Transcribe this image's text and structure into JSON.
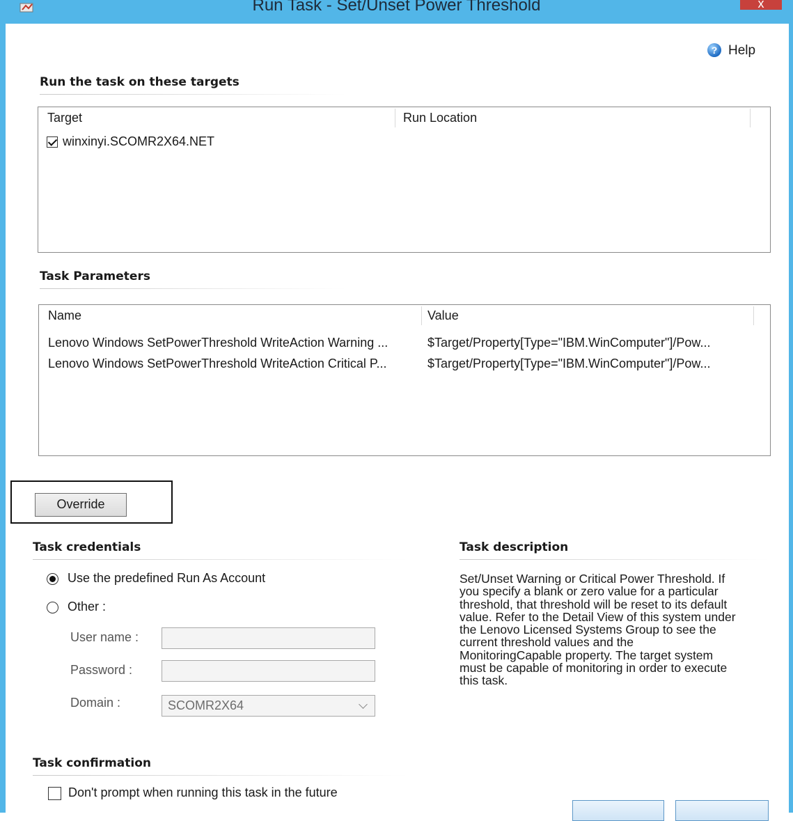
{
  "window": {
    "title": "Run Task - Set/Unset Power Threshold",
    "close_glyph": "x"
  },
  "help": {
    "label": "Help",
    "icon": "help-icon"
  },
  "targets": {
    "heading": "Run the task on these targets",
    "columns": [
      "Target",
      "Run Location"
    ],
    "rows": [
      {
        "checked": true,
        "target": "winxinyi.SCOMR2X64.NET",
        "run_location": ""
      }
    ]
  },
  "parameters": {
    "heading": "Task Parameters",
    "columns": [
      "Name",
      "Value"
    ],
    "rows": [
      {
        "name": "Lenovo Windows SetPowerThreshold WriteAction Warning ...",
        "value": "$Target/Property[Type=\"IBM.WinComputer\"]/Pow..."
      },
      {
        "name": "Lenovo Windows SetPowerThreshold WriteAction Critical P...",
        "value": "$Target/Property[Type=\"IBM.WinComputer\"]/Pow..."
      }
    ]
  },
  "override_label": "Override",
  "credentials": {
    "heading": "Task credentials",
    "option_predefined": "Use the predefined Run As Account",
    "option_other": "Other :",
    "selected": "predefined",
    "username_label": "User name :",
    "username_value": "",
    "password_label": "Password :",
    "password_value": "",
    "domain_label": "Domain :",
    "domain_value": "SCOMR2X64"
  },
  "description": {
    "heading": "Task description",
    "text": "Set/Unset Warning or Critical Power Threshold. If you specify a blank or zero value for a particular threshold, that threshold will be reset to its default value. Refer to the Detail View of this system under the Lenovo Licensed Systems Group to see the current threshold values and the MonitoringCapable property. The target system must be capable of monitoring in order to execute this task."
  },
  "confirmation": {
    "heading": "Task confirmation",
    "dont_prompt_label": "Don't prompt when running this task in the future",
    "dont_prompt_checked": false
  },
  "colors": {
    "frame": "#52b6e8",
    "close": "#c7413c"
  }
}
